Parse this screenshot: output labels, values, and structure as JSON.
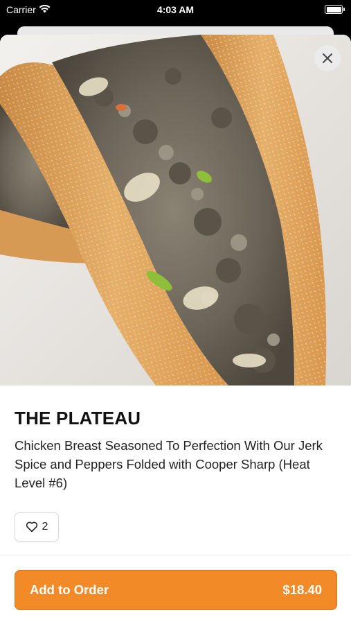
{
  "status_bar": {
    "carrier": "Carrier",
    "time": "4:03 AM",
    "icons": [
      "wifi-icon",
      "battery-icon"
    ]
  },
  "item": {
    "title": "THE PLATEAU",
    "description": "Chicken Breast Seasoned To Perfection With Our Jerk Spice and Peppers Folded with Cooper Sharp (Heat Level #6)",
    "likes": "2",
    "image_alt": "cheesesteak sandwich on seeded roll"
  },
  "actions": {
    "close_icon": "close-icon",
    "like_icon": "heart-icon",
    "add_to_order_label": "Add to Order",
    "price": "$18.40"
  },
  "colors": {
    "accent": "#f28a28",
    "accent_border": "#d9731a"
  }
}
